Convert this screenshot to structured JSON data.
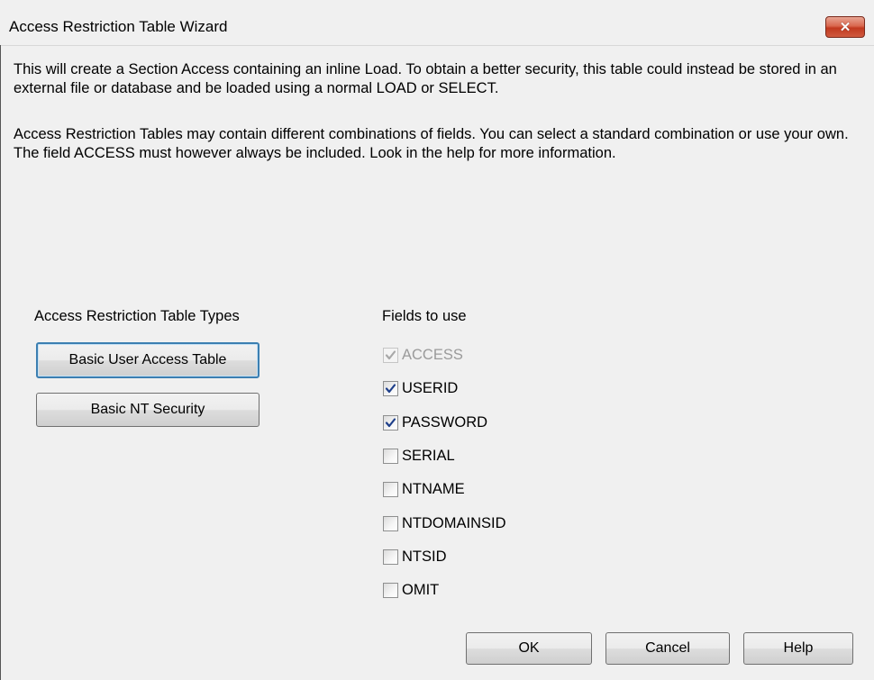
{
  "window": {
    "title": "Access Restriction Table Wizard",
    "close_icon": "close-icon"
  },
  "intro": {
    "paragraph1": "This will create a Section Access containing an inline Load. To obtain a better security, this table could instead be stored in an external file or database and be loaded using a normal LOAD or SELECT.",
    "paragraph2": "Access Restriction Tables may contain different combinations of fields. You can select a standard combination or use your own. The field ACCESS must however always be included. Look in the help for more information."
  },
  "types": {
    "label": "Access Restriction Table Types",
    "basic_user_button": "Basic User Access Table",
    "basic_nt_button": "Basic NT Security"
  },
  "fields": {
    "label": "Fields to use",
    "items": [
      {
        "label": "ACCESS",
        "checked": true,
        "disabled": true
      },
      {
        "label": "USERID",
        "checked": true,
        "disabled": false
      },
      {
        "label": "PASSWORD",
        "checked": true,
        "disabled": false
      },
      {
        "label": "SERIAL",
        "checked": false,
        "disabled": false
      },
      {
        "label": "NTNAME",
        "checked": false,
        "disabled": false
      },
      {
        "label": "NTDOMAINSID",
        "checked": false,
        "disabled": false
      },
      {
        "label": "NTSID",
        "checked": false,
        "disabled": false
      },
      {
        "label": "OMIT",
        "checked": false,
        "disabled": false
      }
    ]
  },
  "footer": {
    "ok": "OK",
    "cancel": "Cancel",
    "help": "Help"
  },
  "colors": {
    "check_enabled": "#1e3f8a",
    "check_disabled": "#a8a8a8",
    "close_button": "#c7432a"
  }
}
